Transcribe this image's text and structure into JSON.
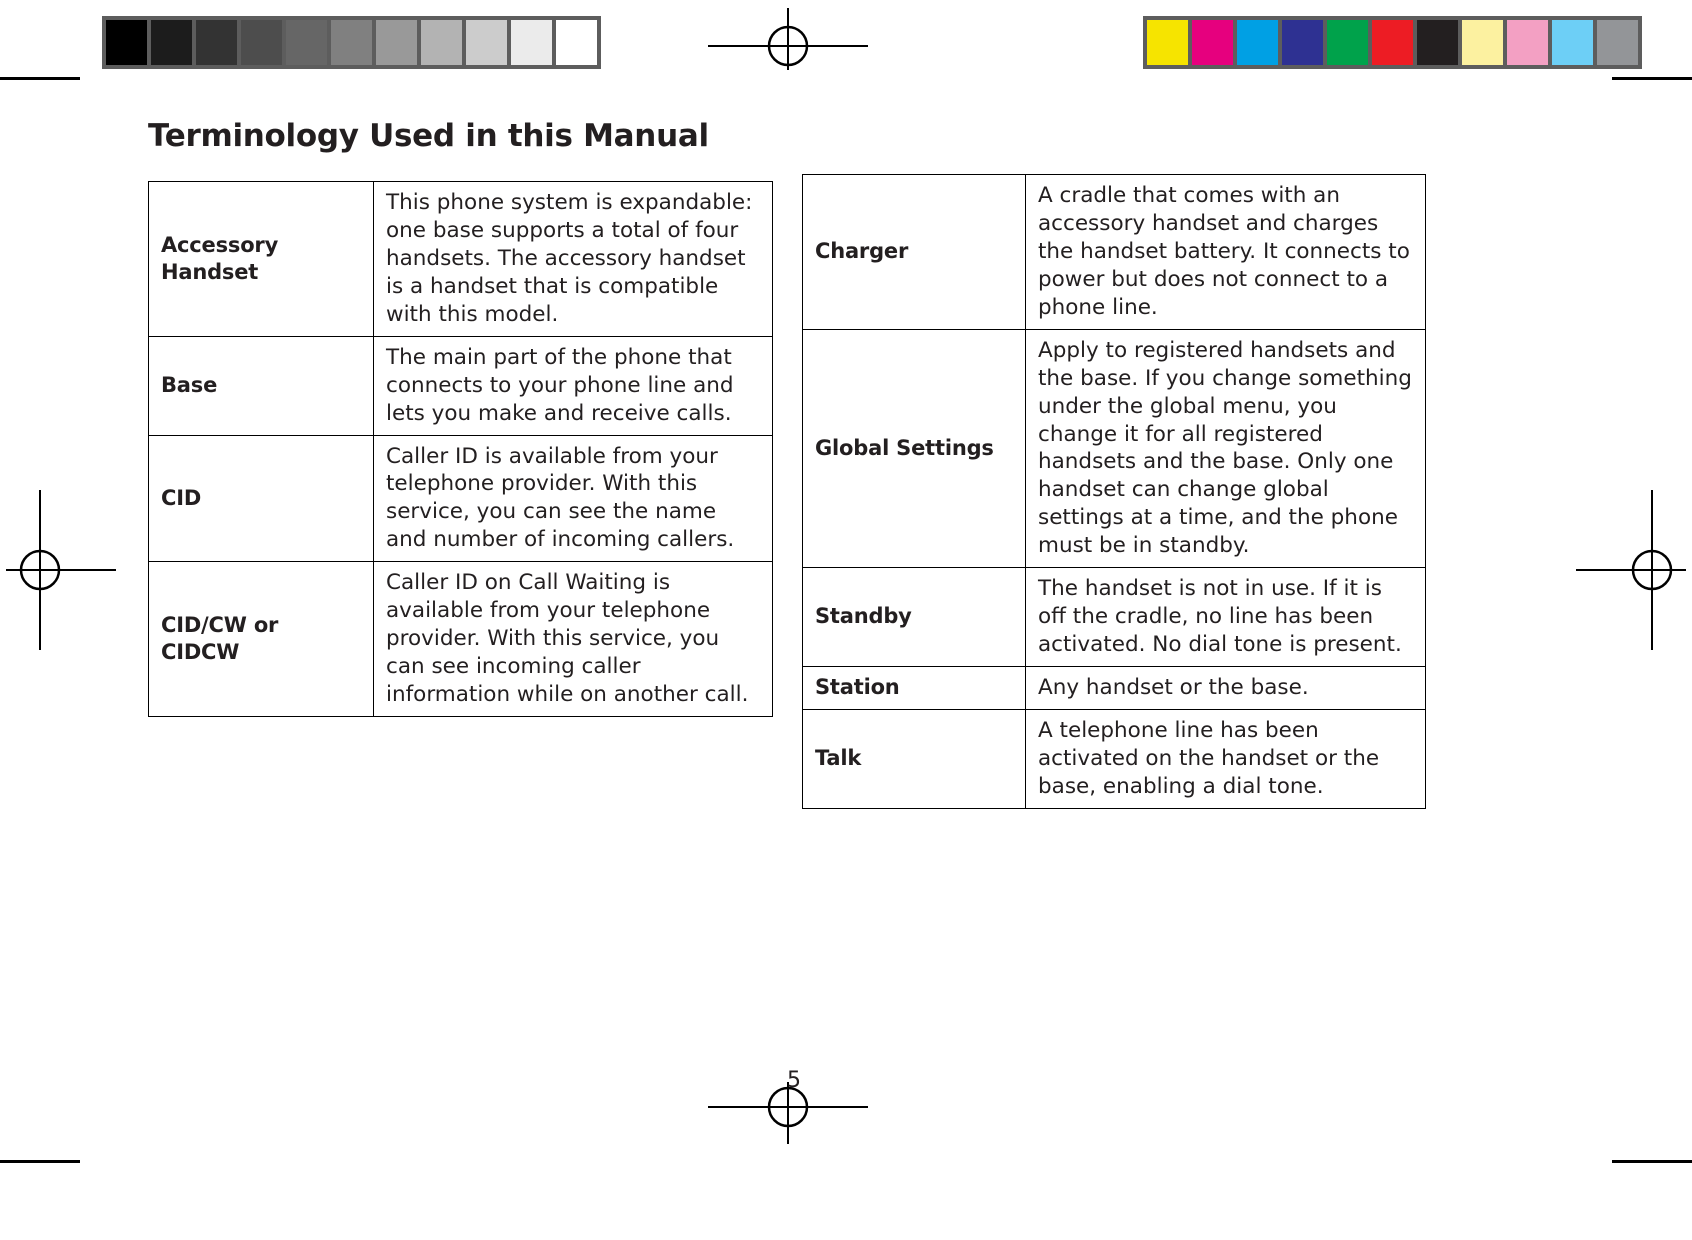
{
  "document": {
    "title": "Terminology Used in this Manual",
    "page_number": "5"
  },
  "calibration": {
    "grayscale_label": "grayscale-calibration-strip",
    "grayscale_swatches": [
      "#000000",
      "#1c1c1c",
      "#333333",
      "#4d4d4d",
      "#666666",
      "#808080",
      "#999999",
      "#b3b3b3",
      "#cccccc",
      "#ebebeb",
      "#ffffff"
    ],
    "color_label": "color-calibration-strip",
    "color_swatches": [
      "#f6e400",
      "#e6007e",
      "#00a0e4",
      "#2e3192",
      "#00a24b",
      "#ed1c24",
      "#231f20",
      "#fcf1a0",
      "#f3a0c3",
      "#6dcff6",
      "#939598"
    ],
    "strip_background": "#5d5d5d"
  },
  "tables": {
    "left": {
      "name": "terminology-table-left",
      "rows": [
        {
          "term": "Accessory Handset",
          "definition": "This phone system is expandable: one base supports a total of four handsets. The accessory handset is a handset that is compatible with this model."
        },
        {
          "term": "Base",
          "definition": "The main part of the phone that connects to your phone line and lets you make and receive calls."
        },
        {
          "term": "CID",
          "definition": "Caller ID is available from your telephone provider. With this service, you can see the name and number of incoming callers."
        },
        {
          "term": "CID/CW or CIDCW",
          "definition": "Caller ID on Call Waiting is available from your telephone provider. With this service, you can see incoming caller information while on another call."
        }
      ]
    },
    "right": {
      "name": "terminology-table-right",
      "rows": [
        {
          "term": "Charger",
          "definition": "A cradle that comes with an accessory handset and charges the handset battery. It connects to power but does not connect to a phone line."
        },
        {
          "term": "Global Settings",
          "definition": "Apply to registered handsets and the base. If you change something under the global menu, you change it for all registered handsets and the base. Only one handset can change global settings at a time, and the phone must be in standby."
        },
        {
          "term": "Standby",
          "definition": "The handset is not in use. If it is off the cradle, no line has been activated. No dial tone is present."
        },
        {
          "term": "Station",
          "definition": "Any handset or the base."
        },
        {
          "term": "Talk",
          "definition": "A telephone line has been activated on the handset or the base, enabling a dial tone."
        }
      ]
    }
  }
}
